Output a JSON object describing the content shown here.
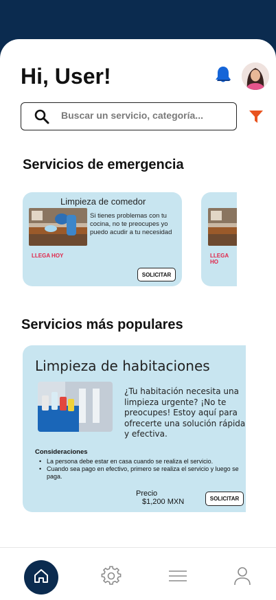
{
  "header": {
    "greeting": "Hi, User!"
  },
  "search": {
    "placeholder": "Buscar un servicio, categoría..."
  },
  "emergency": {
    "title": "Servicios de emergencia",
    "cards": [
      {
        "title": "Limpieza de comedor",
        "description": "Si tienes problemas con tu cocina, no te preocupes yo puedo acudir a tu necesidad",
        "tag": "LLEGA HOY",
        "button": "SOLICITAR"
      },
      {
        "title": "",
        "description": "",
        "tag": "LLEGA HO",
        "button": ""
      }
    ]
  },
  "popular": {
    "title": "Servicios más populares",
    "card": {
      "title": "Limpieza de habitaciones",
      "description": "¿Tu habitación necesita una limpieza urgente? ¡No te preocupes! Estoy aquí para ofrecerte una solución rápida y efectiva.",
      "considerations_title": "Consideraciones",
      "considerations": [
        "La persona debe estar en casa cuando se realiza el servicio.",
        "Cuando sea pago en efectivo, primero se realiza el servicio y luego se paga."
      ],
      "price_label": "Precio",
      "price_value": "$1,200 MXN",
      "button": "SOLICITAR"
    }
  },
  "tabs": [
    {
      "icon": "home-icon",
      "active": true
    },
    {
      "icon": "gear-icon",
      "active": false
    },
    {
      "icon": "menu-icon",
      "active": false
    },
    {
      "icon": "user-icon",
      "active": false
    }
  ],
  "colors": {
    "header_bg": "#0b2b4f",
    "card_bg": "#c8e5f0",
    "tag_red": "#e0264a",
    "bell_blue": "#1565d8",
    "filter_orange": "#e8531f"
  }
}
